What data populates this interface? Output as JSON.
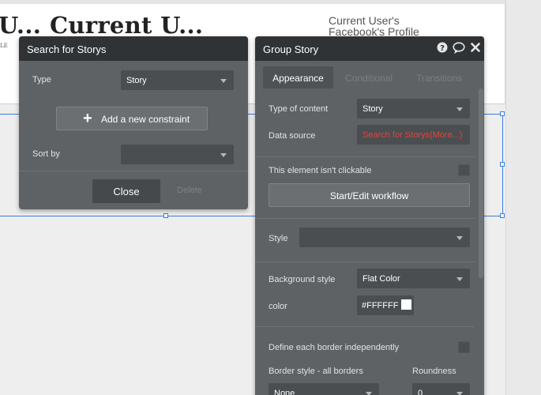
{
  "canvas": {
    "title_left": "U...",
    "title_main": "Current U...",
    "tiny_text": "LE",
    "facebook_text": "Current User's Facebook's Profile"
  },
  "search_panel": {
    "title": "Search for Storys",
    "type_label": "Type",
    "type_value": "Story",
    "add_constraint_label": "Add a new constraint",
    "sort_by_label": "Sort by",
    "sort_by_value": "",
    "close_label": "Close",
    "delete_label": "Delete"
  },
  "group_panel": {
    "title": "Group Story",
    "icons": [
      "help-icon",
      "comment-icon",
      "close-icon"
    ],
    "tabs": [
      {
        "label": "Appearance",
        "active": true
      },
      {
        "label": "Conditional",
        "active": false
      },
      {
        "label": "Transitions",
        "active": false
      }
    ],
    "type_of_content_label": "Type of content",
    "type_of_content_value": "Story",
    "data_source_label": "Data source",
    "data_source_value": "Search for Storys(More...)",
    "not_clickable_label": "This element isn't clickable",
    "workflow_label": "Start/Edit workflow",
    "style_label": "Style",
    "style_value": "",
    "bg_style_label": "Background style",
    "bg_style_value": "Flat Color",
    "color_label": "color",
    "color_value": "#FFFFFF",
    "border_independent_label": "Define each border independently",
    "border_style_label": "Border style - all borders",
    "roundness_label": "Roundness",
    "border_style_value": "None",
    "roundness_value": "0"
  },
  "colors": {
    "panel_bg": "#5e6264",
    "header_bg": "#2f3335",
    "data_source_red": "#e8413f",
    "selection_blue": "#3b7ddd"
  }
}
